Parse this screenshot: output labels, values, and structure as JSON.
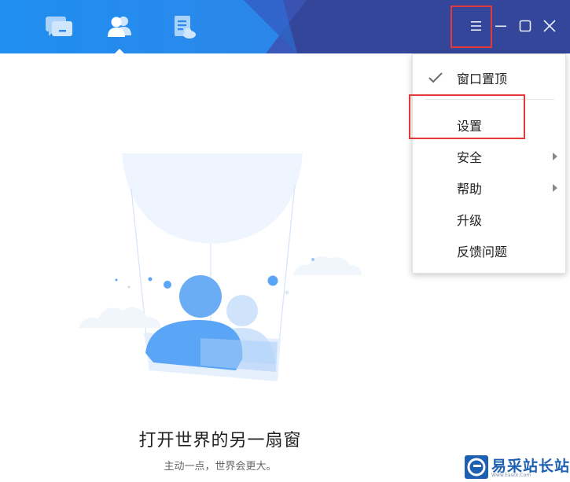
{
  "colors": {
    "titlebar_start": "#1f8ef0",
    "titlebar_end": "#2f66d6",
    "accent_dark": "#34469a",
    "highlight_red": "#e5383b",
    "illustration_blue": "#5aa5f5"
  },
  "nav": {
    "tabs": [
      {
        "name": "messages",
        "icon": "chat-icon",
        "active": false
      },
      {
        "name": "contacts",
        "icon": "contacts-icon",
        "active": true
      },
      {
        "name": "files",
        "icon": "document-icon",
        "active": false
      }
    ]
  },
  "window_controls": [
    {
      "icon": "menu-icon"
    },
    {
      "icon": "minimize-icon"
    },
    {
      "icon": "maximize-icon"
    },
    {
      "icon": "close-icon"
    }
  ],
  "menu": {
    "items": [
      {
        "label": "窗口置顶",
        "checked": true,
        "submenu": false
      },
      {
        "label": "设置",
        "checked": false,
        "submenu": false
      },
      {
        "label": "安全",
        "checked": false,
        "submenu": true
      },
      {
        "label": "帮助",
        "checked": false,
        "submenu": true
      },
      {
        "label": "升级",
        "checked": false,
        "submenu": false
      },
      {
        "label": "反馈问题",
        "checked": false,
        "submenu": false
      }
    ]
  },
  "main": {
    "headline": "打开世界的另一扇窗",
    "subline": "主动一点，世界会更大。"
  },
  "watermark": {
    "text": "易采站长站",
    "url": "Www.Easck.Com"
  }
}
